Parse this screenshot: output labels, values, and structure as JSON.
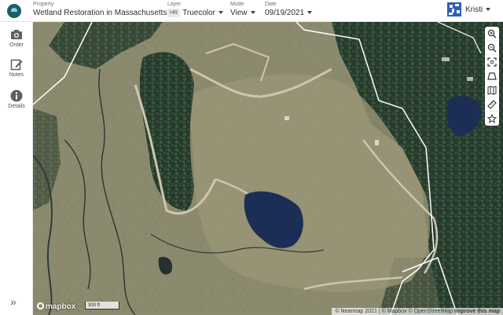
{
  "header": {
    "property": {
      "caption": "Property",
      "value": "Wetland Restoration in Massachusetts"
    },
    "layer": {
      "caption": "Layer",
      "badge": "HR",
      "value": "Truecolor"
    },
    "mode": {
      "caption": "Mode",
      "value": "View"
    },
    "date": {
      "caption": "Date",
      "value": "09/19/2021"
    },
    "user": {
      "name": "Kristi"
    }
  },
  "sidebar": {
    "items": [
      {
        "label": "Order",
        "icon": "camera-icon"
      },
      {
        "label": "Notes",
        "icon": "edit-icon"
      },
      {
        "label": "Details",
        "icon": "info-icon"
      }
    ],
    "expand_icon": "»"
  },
  "map": {
    "tools": [
      "zoom-in-icon",
      "zoom-out-icon",
      "fit-extent-icon",
      "polygon-icon",
      "map-layers-icon",
      "ruler-icon",
      "star-icon"
    ],
    "scale_label": "300 ft",
    "mapbox_label": "mapbox",
    "attribution": {
      "nearmap": "© Nearmap 2021",
      "mapbox": "© Mapbox",
      "osm": "© OpenStreetMap",
      "improve": "Improve this map"
    }
  },
  "colors": {
    "brand": "#1c5f6b",
    "avatar": "#2c5fb8",
    "water": "#1c2e56"
  }
}
